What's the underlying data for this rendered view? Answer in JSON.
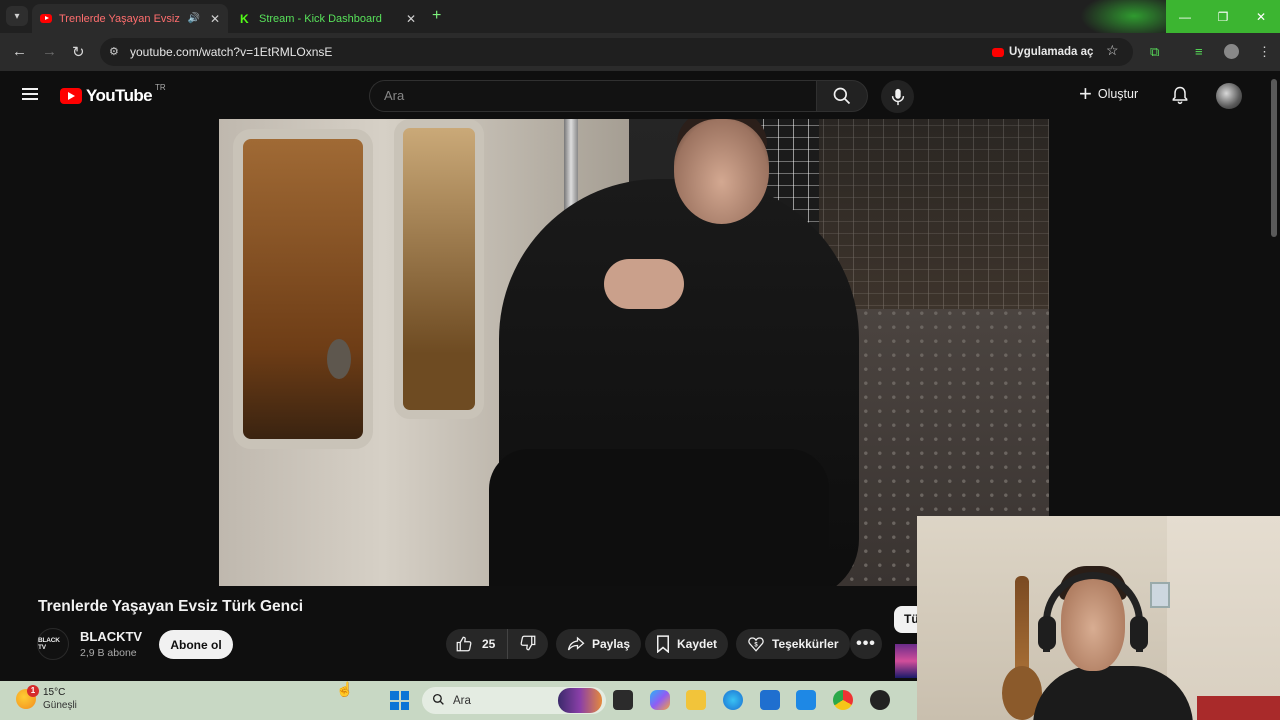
{
  "browser": {
    "tabs": [
      {
        "title": "Trenlerde Yaşayan Evsiz Türk",
        "active": true,
        "favicon": "youtube-icon"
      },
      {
        "title": "Stream - Kick Dashboard",
        "active": false,
        "favicon": "kick-icon"
      }
    ],
    "close_glyph": "✕",
    "new_tab_glyph": "+",
    "url": "youtube.com/watch?v=1EtRMLOxnsE",
    "open_in_app_label": "Uygulamada aç",
    "window_controls": {
      "minimize": "—",
      "maximize": "❐",
      "close": "✕"
    }
  },
  "youtube": {
    "logo_text": "YouTube",
    "country_code": "TR",
    "search_placeholder": "Ara",
    "create_label": "Oluştur",
    "video": {
      "title": "Trenlerde Yaşayan Evsiz Türk Genci",
      "channel": {
        "name": "BLACKTV",
        "avatar_text": "BLACK TV",
        "subscribers": "2,9 B abone"
      },
      "subscribe_label": "Abone ol",
      "likes": "25",
      "share_label": "Paylaş",
      "save_label": "Kaydet",
      "thanks_label": "Teşekkürler",
      "more_glyph": "•••"
    },
    "side_chip_label": "Tü"
  },
  "taskbar": {
    "weather_temp": "15°C",
    "weather_condition": "Güneşli",
    "weather_badge": "1",
    "search_label": "Ara"
  },
  "colors": {
    "youtube_red": "#ff0000",
    "kick_green": "#53fc18",
    "page_bg": "#0f0f0f",
    "taskbar_bg": "#c8d8c4"
  }
}
